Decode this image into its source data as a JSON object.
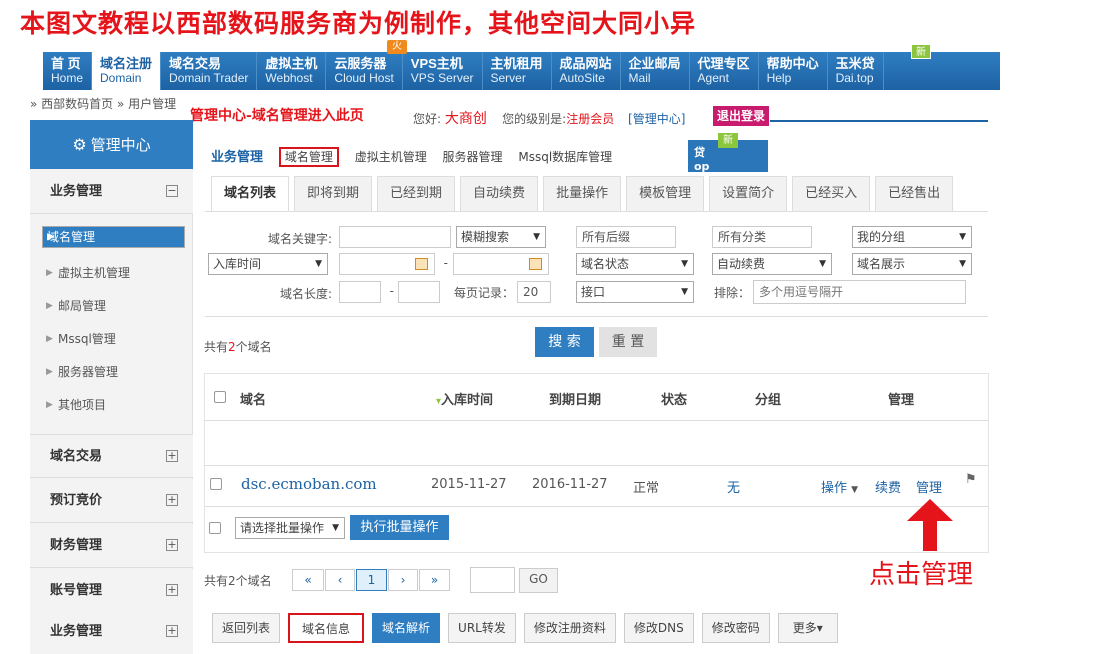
{
  "tutorial": {
    "title": "本图文教程以西部数码服务商为例制作，其他空间大同小异",
    "annotation_top": "管理中心-域名管理进入此页",
    "annotation_bottom": "点击管理"
  },
  "nav": {
    "items": [
      {
        "cn": "首 页",
        "en": "Home"
      },
      {
        "cn": "域名注册",
        "en": "Domain"
      },
      {
        "cn": "域名交易",
        "en": "Domain Trader"
      },
      {
        "cn": "虚拟主机",
        "en": "Webhost"
      },
      {
        "cn": "云服务器",
        "en": "Cloud Host"
      },
      {
        "cn": "VPS主机",
        "en": "VPS Server"
      },
      {
        "cn": "主机租用",
        "en": "Server"
      },
      {
        "cn": "成品网站",
        "en": "AutoSite"
      },
      {
        "cn": "企业邮局",
        "en": "Mail"
      },
      {
        "cn": "代理专区",
        "en": "Agent"
      },
      {
        "cn": "帮助中心",
        "en": "Help"
      },
      {
        "cn": "玉米贷",
        "en": "Dai.top"
      }
    ],
    "hot_badge": "火",
    "new_badge": "新"
  },
  "breadcrumb": "» 西部数码首页 » 用户管理",
  "user": {
    "hello_label": "您好:",
    "name": "大商创",
    "level_label": "您的级别是:",
    "level": "注册会员",
    "center_link": "[管理中心]",
    "logout": "退出登录"
  },
  "ghost_text": "贷",
  "ghost_sub": "op",
  "sidebar": {
    "header": "管理中心",
    "section_business": "业务管理",
    "items": [
      "域名管理",
      "虚拟主机管理",
      "邮局管理",
      "Mssql管理",
      "服务器管理",
      "其他项目"
    ],
    "sections": [
      "域名交易",
      "预订竞价",
      "财务管理",
      "账号管理",
      "业务管理"
    ]
  },
  "subtabs": {
    "title": "业务管理",
    "items": [
      "域名管理",
      "虚拟主机管理",
      "服务器管理",
      "Mssql数据库管理"
    ]
  },
  "tabs": [
    "域名列表",
    "即将到期",
    "已经到期",
    "自动续费",
    "批量操作",
    "模板管理",
    "设置简介",
    "已经买入",
    "已经售出"
  ],
  "filters": {
    "keyword_label": "域名关键字:",
    "fuzzy": "模糊搜索",
    "suffix": "所有后缀",
    "category": "所有分类",
    "group": "我的分组",
    "date_field": "入库时间",
    "dash": "-",
    "status": "域名状态",
    "auto_renew": "自动续费",
    "display": "域名展示",
    "length_label": "域名长度:",
    "per_page_label": "每页记录：",
    "per_page": "20",
    "interface": "接口",
    "exclude_label": "排除：",
    "exclude_placeholder": "多个用逗号隔开"
  },
  "count_text_prefix": "共有",
  "count": "2",
  "count_text_suffix": "个域名",
  "search_button": "搜 索",
  "reset_button": "重 置",
  "table": {
    "headers": [
      "域名",
      "入库时间",
      "到期日期",
      "状态",
      "分组",
      "管理"
    ],
    "sort_marker": "▾",
    "rows": [
      {
        "domain": "dsc.ecmoban.com",
        "added": "2015-11-27",
        "expires": "2016-11-27",
        "status": "正常",
        "group": "无",
        "op": "操作",
        "renew": "续费",
        "manage": "管理"
      }
    ]
  },
  "batch": {
    "select": "请选择批量操作",
    "run": "执行批量操作"
  },
  "pager": {
    "summary": "共有2个域名",
    "first": "«",
    "prev": "‹",
    "page": "1",
    "next": "›",
    "last": "»",
    "go": "GO"
  },
  "bottom_tabs": [
    "返回列表",
    "域名信息",
    "域名解析",
    "URL转发",
    "修改注册资料",
    "修改DNS",
    "修改密码",
    "更多▾"
  ]
}
